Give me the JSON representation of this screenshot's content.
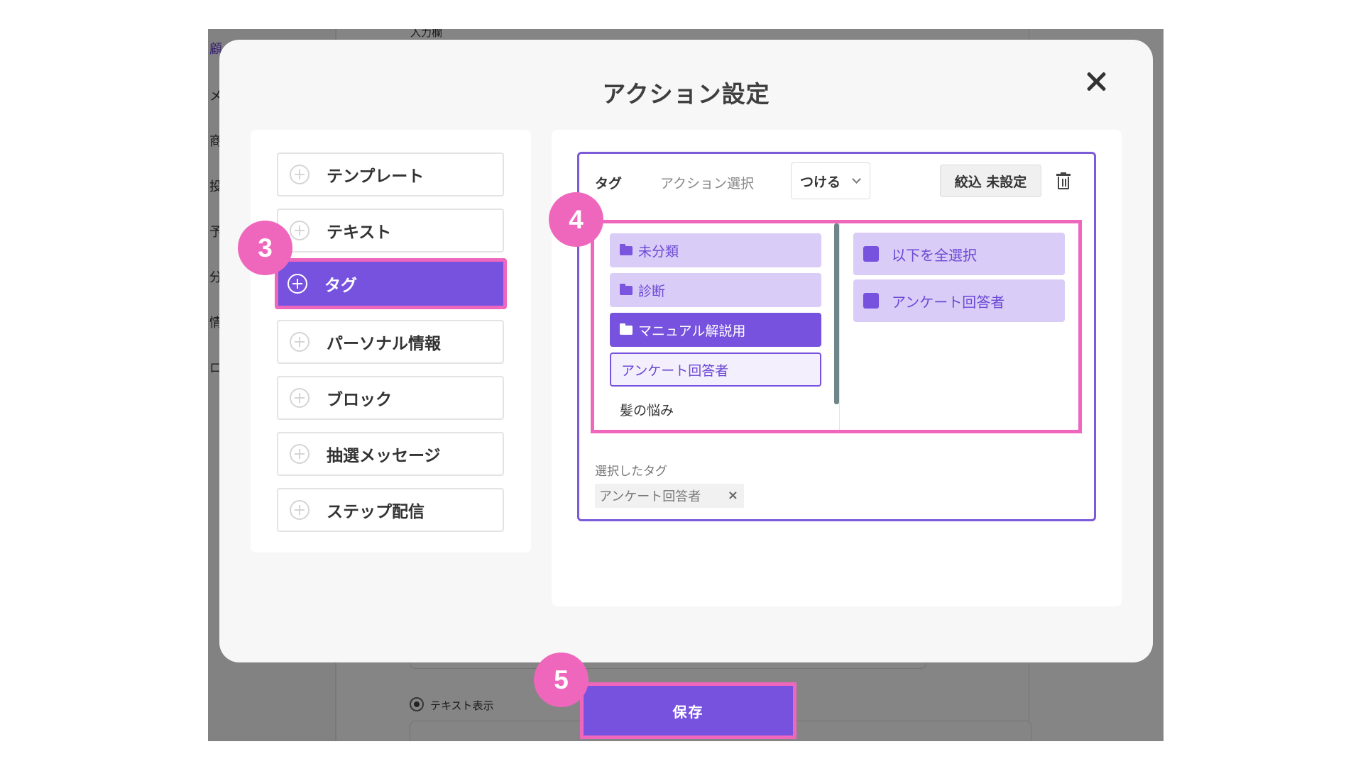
{
  "background_app": {
    "sidebar_items": [
      "顧",
      "メ",
      "商",
      "投",
      "予",
      "分",
      "情",
      "ロ"
    ],
    "input_label": "入力欄",
    "radio_label": "テキスト表示"
  },
  "modal": {
    "title": "アクション設定",
    "close_icon": "close-icon"
  },
  "menu": {
    "items": [
      {
        "label": "テンプレート"
      },
      {
        "label": "テキスト"
      },
      {
        "label": "タグ"
      },
      {
        "label": "パーソナル情報"
      },
      {
        "label": "ブロック"
      },
      {
        "label": "抽選メッセージ"
      },
      {
        "label": "ステップ配信"
      }
    ],
    "active_index": 2
  },
  "action": {
    "type_label": "タグ",
    "action_select_label": "アクション選択",
    "action_value": "つける",
    "filter_button": "絞込 未設定",
    "delete_icon": "trash-icon"
  },
  "tag_picker": {
    "categories": [
      {
        "label": "未分類",
        "folder": true,
        "state": "light"
      },
      {
        "label": "診断",
        "folder": true,
        "state": "light"
      },
      {
        "label": "マニュアル解説用",
        "folder": true,
        "state": "selected"
      },
      {
        "label": "アンケート回答者",
        "folder": false,
        "state": "outlined"
      },
      {
        "label": "髪の悩み",
        "folder": false,
        "state": "plain"
      }
    ],
    "options": [
      {
        "label": "以下を全選択"
      },
      {
        "label": "アンケート回答者"
      }
    ]
  },
  "selected_tags": {
    "label": "選択したタグ",
    "tags": [
      "アンケート回答者"
    ],
    "remove_symbol": "×"
  },
  "save_button": "保存",
  "steps": [
    "3",
    "4",
    "5"
  ],
  "colors": {
    "accent": "#7752df",
    "accent_light": "#d9ccf7",
    "highlight": "#ef67bd"
  }
}
